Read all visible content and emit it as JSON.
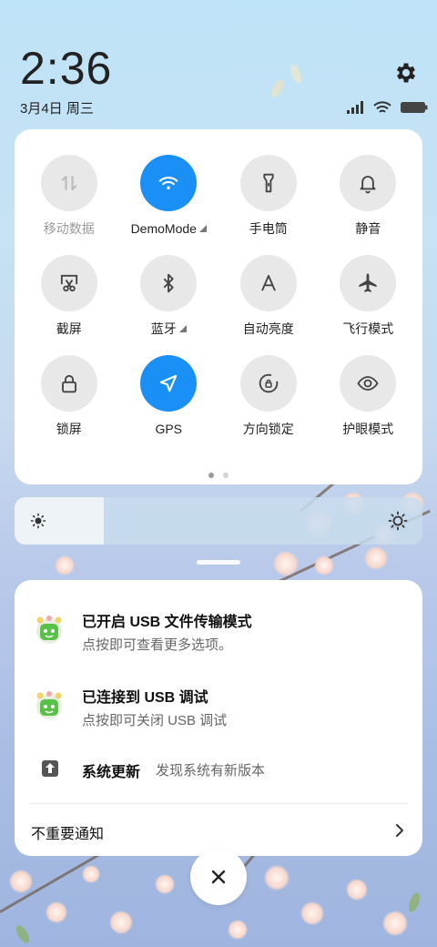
{
  "status": {
    "time": "2:36",
    "date": "3月4日 周三"
  },
  "quick_settings": {
    "tiles": [
      {
        "label": "移动数据",
        "icon": "mobile-data-icon",
        "active": false,
        "disabled": true,
        "expand": false
      },
      {
        "label": "DemoMode",
        "icon": "wifi-icon",
        "active": true,
        "disabled": false,
        "expand": true
      },
      {
        "label": "手电筒",
        "icon": "flashlight-icon",
        "active": false,
        "disabled": false,
        "expand": false
      },
      {
        "label": "静音",
        "icon": "bell-icon",
        "active": false,
        "disabled": false,
        "expand": false
      },
      {
        "label": "截屏",
        "icon": "screenshot-icon",
        "active": false,
        "disabled": false,
        "expand": false
      },
      {
        "label": "蓝牙",
        "icon": "bluetooth-icon",
        "active": false,
        "disabled": false,
        "expand": true
      },
      {
        "label": "自动亮度",
        "icon": "auto-brightness-icon",
        "active": false,
        "disabled": false,
        "expand": false
      },
      {
        "label": "飞行模式",
        "icon": "airplane-icon",
        "active": false,
        "disabled": false,
        "expand": false
      },
      {
        "label": "锁屏",
        "icon": "lock-icon",
        "active": false,
        "disabled": false,
        "expand": false
      },
      {
        "label": "GPS",
        "icon": "gps-icon",
        "active": true,
        "disabled": false,
        "expand": false
      },
      {
        "label": "方向锁定",
        "icon": "rotation-lock-icon",
        "active": false,
        "disabled": false,
        "expand": false
      },
      {
        "label": "护眼模式",
        "icon": "eye-icon",
        "active": false,
        "disabled": false,
        "expand": false
      }
    ],
    "page_count": 2,
    "current_page": 1
  },
  "brightness": {
    "level": 0.2
  },
  "notifications": {
    "items": [
      {
        "title": "已开启 USB 文件传输模式",
        "text": "点按即可查看更多选项。",
        "icon": "android-icon"
      },
      {
        "title": "已连接到 USB 调试",
        "text": "点按即可关闭 USB 调试",
        "icon": "android-icon"
      },
      {
        "title": "系统更新",
        "text": "发现系统有新版本",
        "icon": "upload-icon"
      }
    ],
    "unimportant_label": "不重要通知"
  },
  "colors": {
    "accent": "#1a8ff5",
    "tile_inactive": "#e8e8e8"
  }
}
